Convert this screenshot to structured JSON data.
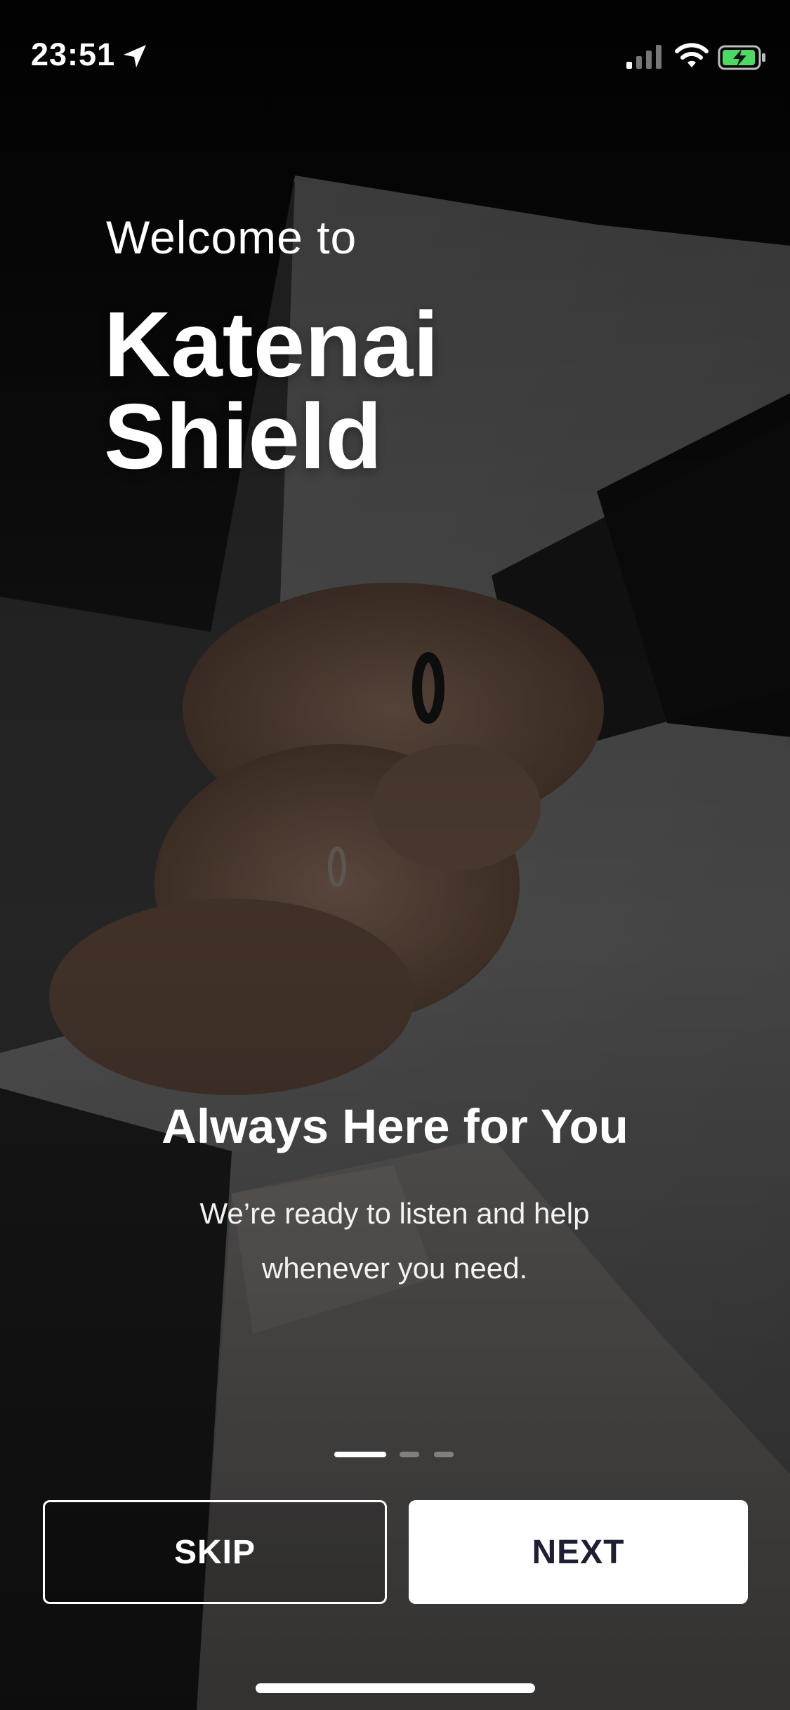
{
  "status_bar": {
    "time": "23:51",
    "icons": [
      "location-arrow-icon",
      "cellular-signal-icon",
      "wifi-icon",
      "battery-charging-icon"
    ],
    "battery_color": "#4cd964"
  },
  "header": {
    "welcome": "Welcome to",
    "app_name_line1": "Katenai",
    "app_name_line2": "Shield"
  },
  "slide": {
    "title": "Always Here for You",
    "description_line1": "We’re ready to listen and help",
    "description_line2": "whenever you need."
  },
  "pager": {
    "total": 3,
    "active": 1
  },
  "actions": {
    "skip_label": "SKIP",
    "next_label": "NEXT"
  },
  "colors": {
    "next_text": "#1f1f33",
    "overlay": "#000000"
  }
}
